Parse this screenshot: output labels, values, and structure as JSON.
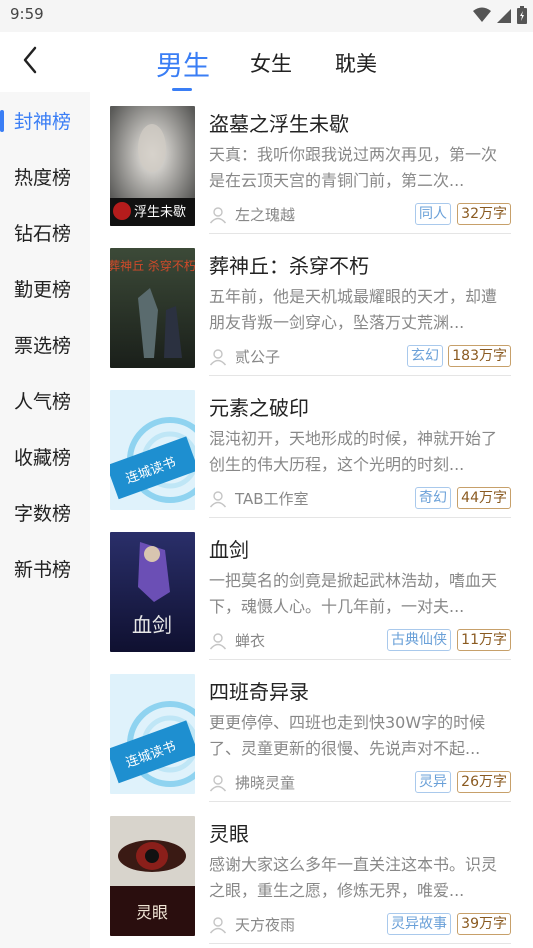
{
  "status_bar": {
    "time": "9:59"
  },
  "tabs": [
    {
      "label": "男生",
      "active": true
    },
    {
      "label": "女生",
      "active": false
    },
    {
      "label": "耽美",
      "active": false
    }
  ],
  "sidebar": {
    "items": [
      {
        "label": "封神榜",
        "active": true
      },
      {
        "label": "热度榜",
        "active": false
      },
      {
        "label": "钻石榜",
        "active": false
      },
      {
        "label": "勤更榜",
        "active": false
      },
      {
        "label": "票选榜",
        "active": false
      },
      {
        "label": "人气榜",
        "active": false
      },
      {
        "label": "收藏榜",
        "active": false
      },
      {
        "label": "字数榜",
        "active": false
      },
      {
        "label": "新书榜",
        "active": false
      }
    ]
  },
  "books": [
    {
      "title": "盗墓之浮生未歇",
      "desc": "天真：我听你跟我说过两次再见，第一次是在云顶天宫的青铜门前，第二次...",
      "author": "左之瑰越",
      "genre": "同人",
      "words": "32万字",
      "cover_text": "浮生未歇"
    },
    {
      "title": "葬神丘：杀穿不朽",
      "desc": "五年前，他是天机城最耀眼的天才，却遭朋友背叛一剑穿心，坠落万丈荒渊...",
      "author": "贰公子",
      "genre": "玄幻",
      "words": "183万字",
      "cover_text": "葬神丘 杀穿不朽"
    },
    {
      "title": "元素之破印",
      "desc": "混沌初开，天地形成的时候，神就开始了创生的伟大历程，这个光明的时刻...",
      "author": "TAB工作室",
      "genre": "奇幻",
      "words": "44万字",
      "cover_text": "连城读书"
    },
    {
      "title": "血剑",
      "desc": "一把莫名的剑竟是掀起武林浩劫，嗜血天下，魂慑人心。十几年前，一对夫...",
      "author": "蝉衣",
      "genre": "古典仙侠",
      "words": "11万字",
      "cover_text": "血剑"
    },
    {
      "title": "四班奇异录",
      "desc": "更更停停、四班也走到快30W字的时候了、灵童更新的很慢、先说声对不起...",
      "author": "拂晓灵童",
      "genre": "灵异",
      "words": "26万字",
      "cover_text": "连城读书"
    },
    {
      "title": "灵眼",
      "desc": "感谢大家这么多年一直关注这本书。识灵之眼，重生之愿，修炼无界，唯爱...",
      "author": "天方夜雨",
      "genre": "灵异故事",
      "words": "39万字",
      "cover_text": "灵眼"
    }
  ]
}
